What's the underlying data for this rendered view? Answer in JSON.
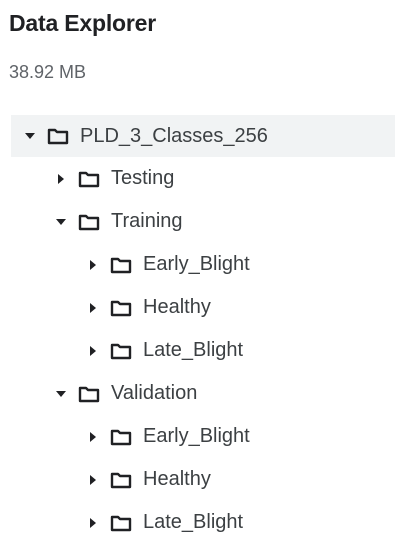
{
  "panel": {
    "title": "Data Explorer",
    "size": "38.92 MB"
  },
  "tree": {
    "root": {
      "label": "PLD_3_Classes_256",
      "expanded": true
    },
    "testing": {
      "label": "Testing",
      "expanded": false
    },
    "training": {
      "label": "Training",
      "expanded": true,
      "children": [
        {
          "label": "Early_Blight",
          "expanded": false
        },
        {
          "label": "Healthy",
          "expanded": false
        },
        {
          "label": "Late_Blight",
          "expanded": false
        }
      ]
    },
    "validation": {
      "label": "Validation",
      "expanded": true,
      "children": [
        {
          "label": "Early_Blight",
          "expanded": false
        },
        {
          "label": "Healthy",
          "expanded": false
        },
        {
          "label": "Late_Blight",
          "expanded": false
        }
      ]
    }
  },
  "icons": {
    "folder": "folder-icon",
    "expanded": "caret-down-icon",
    "collapsed": "caret-right-icon"
  },
  "colors": {
    "root_highlight": "#f1f3f4",
    "text": "#202124",
    "muted": "#5f6368"
  }
}
